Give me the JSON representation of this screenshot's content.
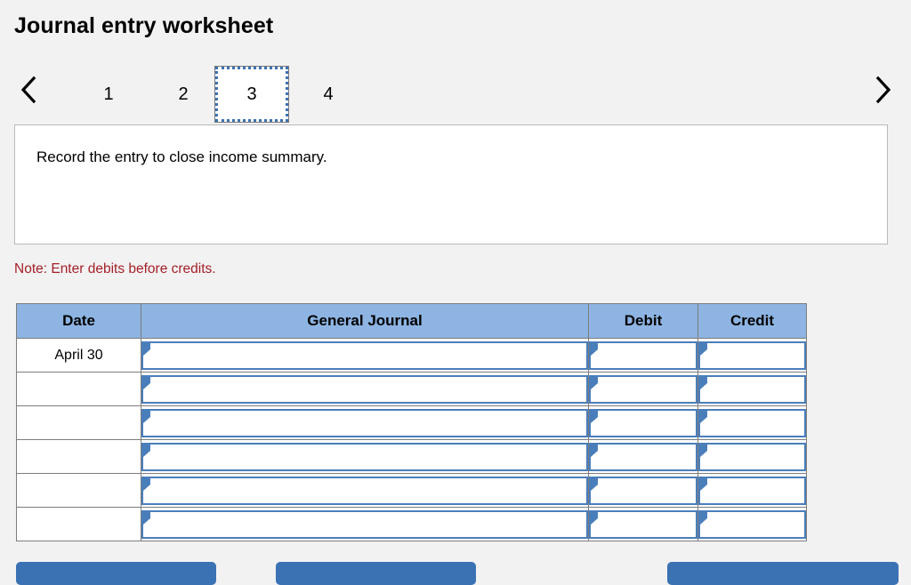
{
  "page_title": "Journal entry worksheet",
  "pager": {
    "prev_icon": "chevron-left-icon",
    "next_icon": "chevron-right-icon",
    "pages": [
      {
        "label": "1",
        "active": false
      },
      {
        "label": "2",
        "active": false
      },
      {
        "label": "3",
        "active": true
      },
      {
        "label": "4",
        "active": false
      }
    ],
    "active_page": "3"
  },
  "instruction": {
    "text": "Record the entry to close income summary."
  },
  "note": {
    "text": "Note: Enter debits before credits.",
    "color": "#a52029"
  },
  "table": {
    "headers": [
      "Date",
      "General Journal",
      "Debit",
      "Credit"
    ],
    "header_bg": "#8db4e2",
    "input_border": "#4a7ebb",
    "rows": [
      {
        "date": "April 30",
        "general_journal": "",
        "debit": "",
        "credit": ""
      },
      {
        "date": "",
        "general_journal": "",
        "debit": "",
        "credit": ""
      },
      {
        "date": "",
        "general_journal": "",
        "debit": "",
        "credit": ""
      },
      {
        "date": "",
        "general_journal": "",
        "debit": "",
        "credit": ""
      },
      {
        "date": "",
        "general_journal": "",
        "debit": "",
        "credit": ""
      },
      {
        "date": "",
        "general_journal": "",
        "debit": "",
        "credit": ""
      }
    ]
  },
  "buttons": {
    "color": "#3b72b4",
    "record_entry": "",
    "clear_entry": "",
    "view_journal": ""
  }
}
